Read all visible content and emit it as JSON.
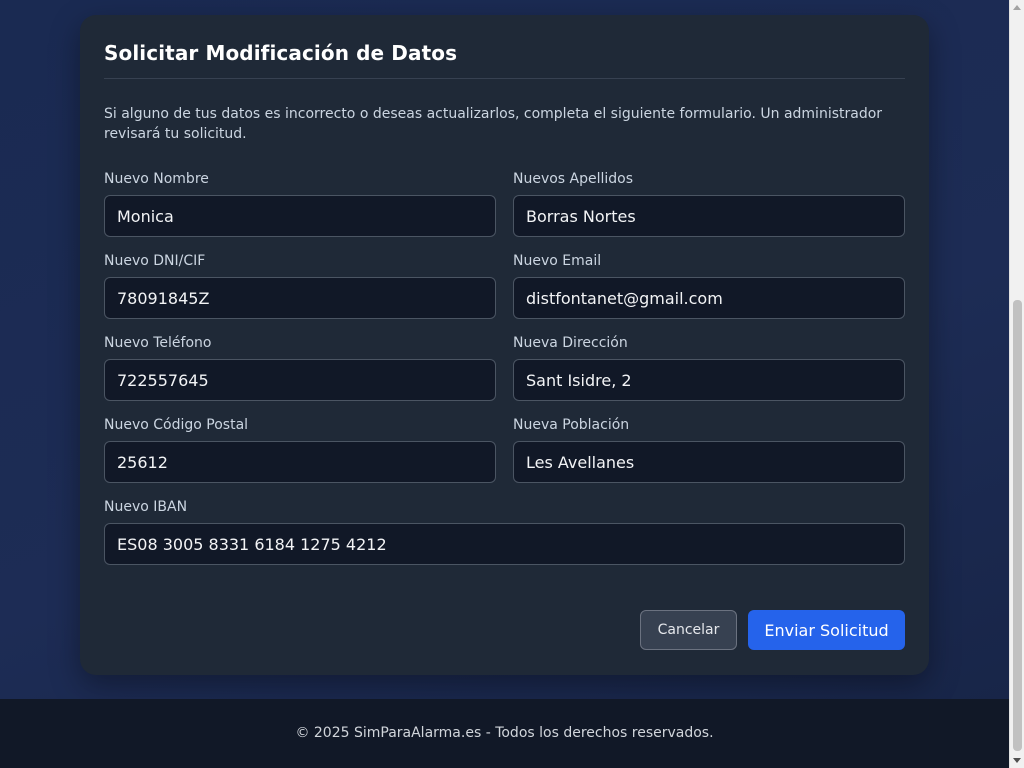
{
  "form": {
    "title": "Solicitar Modificación de Datos",
    "intro": "Si alguno de tus datos es incorrecto o deseas actualizarlos, completa el siguiente formulario. Un administrador revisará tu solicitud.",
    "fields": {
      "nombre": {
        "label": "Nuevo Nombre",
        "value": "Monica"
      },
      "apellidos": {
        "label": "Nuevos Apellidos",
        "value": "Borras Nortes"
      },
      "dni": {
        "label": "Nuevo DNI/CIF",
        "value": "78091845Z"
      },
      "email": {
        "label": "Nuevo Email",
        "value": "distfontanet@gmail.com"
      },
      "telefono": {
        "label": "Nuevo Teléfono",
        "value": "722557645"
      },
      "direccion": {
        "label": "Nueva Dirección",
        "value": "Sant Isidre, 2"
      },
      "cp": {
        "label": "Nuevo Código Postal",
        "value": "25612"
      },
      "poblacion": {
        "label": "Nueva Población",
        "value": "Les Avellanes"
      },
      "iban": {
        "label": "Nuevo IBAN",
        "value": "ES08 3005 8331 6184 1275 4212"
      }
    },
    "buttons": {
      "cancel": "Cancelar",
      "submit": "Enviar Solicitud"
    }
  },
  "footer": {
    "text": "© 2025 SimParaAlarma.es - Todos los derechos reservados."
  },
  "colors": {
    "background": "#1d2c55",
    "card": "#1f2937",
    "input": "#111827",
    "primary": "#2563eb",
    "footer": "#111827"
  }
}
